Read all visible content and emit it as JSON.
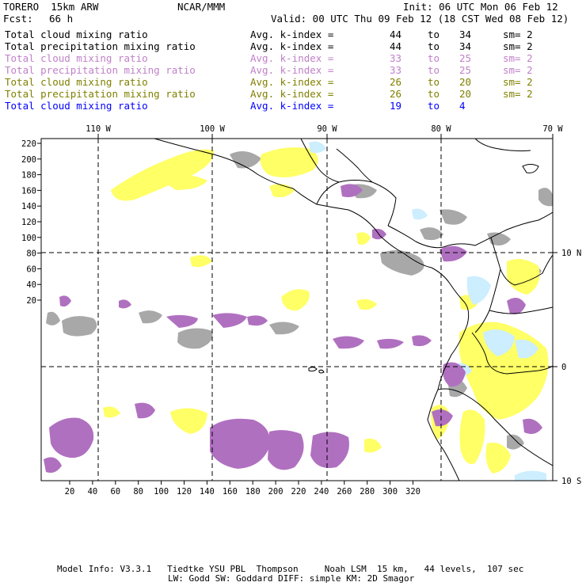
{
  "header": {
    "model": "TORERO  15km ARW",
    "center": "NCAR/MMM",
    "init": "Init: 06 UTC Mon 06 Feb 12",
    "fcst_label": "Fcst:",
    "fcst_value": "66 h",
    "valid": "Valid: 00 UTC Thu 09 Feb 12 (18 CST Wed 08 Feb 12)"
  },
  "legend": [
    {
      "field": "Total cloud mixing ratio",
      "index": "Avg. k-index =",
      "from": "44",
      "to_word": "to",
      "to": "34",
      "sm": "sm= 2",
      "color": "#000000"
    },
    {
      "field": "Total precipitation mixing ratio",
      "index": "Avg. k-index =",
      "from": "44",
      "to_word": "to",
      "to": "34",
      "sm": "sm= 2",
      "color": "#000000"
    },
    {
      "field": "Total cloud mixing ratio",
      "index": "Avg. k-index =",
      "from": "33",
      "to_word": "to",
      "to": "25",
      "sm": "sm= 2",
      "color": "#c080c8"
    },
    {
      "field": "Total precipitation mixing ratio",
      "index": "Avg. k-index =",
      "from": "33",
      "to_word": "to",
      "to": "25",
      "sm": "sm= 2",
      "color": "#c080c8"
    },
    {
      "field": "Total cloud mixing ratio",
      "index": "Avg. k-index =",
      "from": "26",
      "to_word": "to",
      "to": "20",
      "sm": "sm= 2",
      "color": "#808000"
    },
    {
      "field": "Total precipitation mixing ratio",
      "index": "Avg. k-index =",
      "from": "26",
      "to_word": "to",
      "to": "20",
      "sm": "sm= 2",
      "color": "#808000"
    },
    {
      "field": "Total cloud mixing ratio",
      "index": "Avg. k-index =",
      "from": "19",
      "to_word": "to",
      "to": "4",
      "sm": "",
      "color": "#0000ff"
    }
  ],
  "map": {
    "lon_labels": [
      "110 W",
      "100 W",
      "90 W",
      "80 W",
      "70 W"
    ],
    "lat_labels": [
      "10 N",
      "0",
      "10 S"
    ],
    "y_ticks": [
      "220",
      "200",
      "180",
      "160",
      "140",
      "120",
      "100",
      "80",
      "60",
      "40",
      "20"
    ],
    "x_ticks": [
      "20",
      "40",
      "60",
      "80",
      "100",
      "120",
      "140",
      "160",
      "180",
      "200",
      "220",
      "240",
      "260",
      "280",
      "300",
      "320"
    ],
    "colors": {
      "gray": "#a8a8a8",
      "purple": "#b070c0",
      "yellow": "#ffff66",
      "lightblue": "#cceeff"
    }
  },
  "footer": {
    "line1": "Model Info: V3.3.1   Tiedtke YSU PBL  Thompson     Noah LSM  15 km,   44 levels,  107 sec",
    "line2": "LW: Godd SW: Goddard DIFF: simple KM: 2D Smagor"
  }
}
